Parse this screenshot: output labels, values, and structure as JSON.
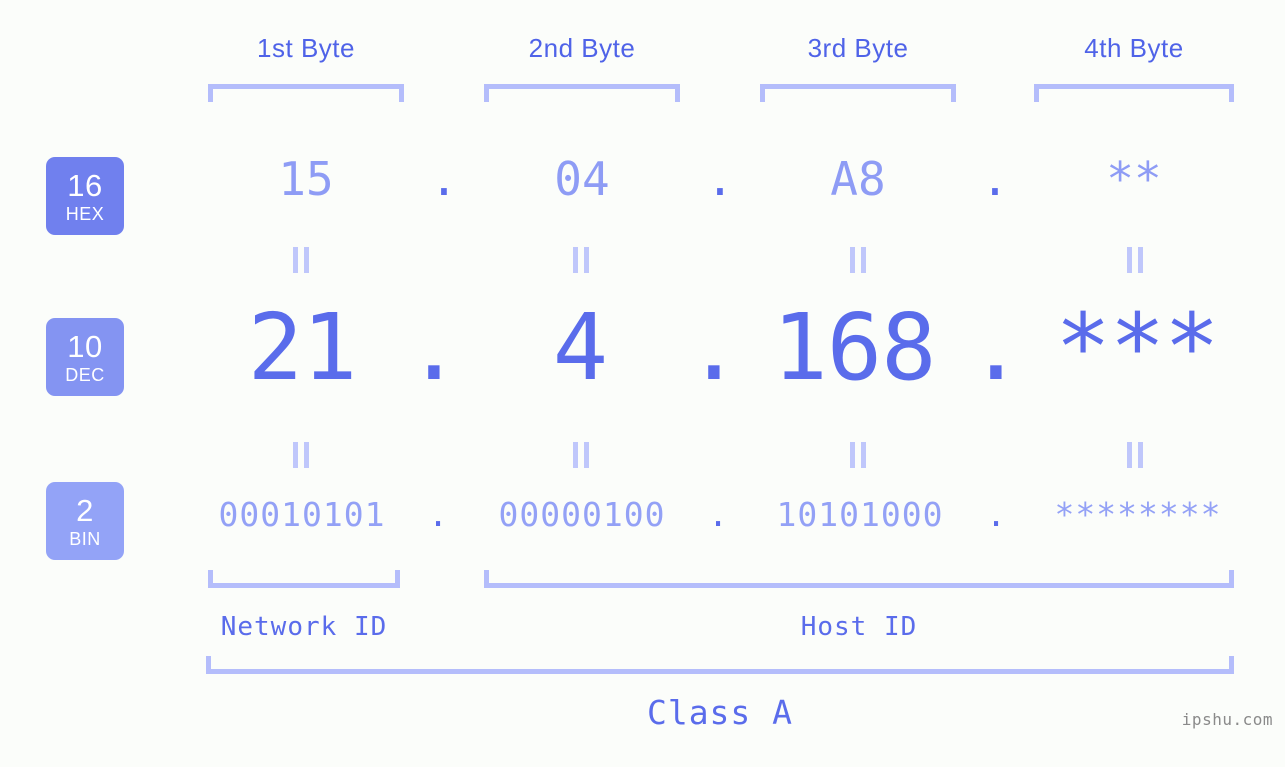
{
  "background_color": "#fbfdfa",
  "accent_color": "#5a6ceb",
  "bracket_color": "#b4bdfb",
  "header": {
    "bytes": [
      {
        "label": "1st Byte"
      },
      {
        "label": "2nd Byte"
      },
      {
        "label": "3rd Byte"
      },
      {
        "label": "4th Byte"
      }
    ]
  },
  "radix_badges": [
    {
      "number": "16",
      "name": "HEX",
      "color": "#7080ee"
    },
    {
      "number": "10",
      "name": "DEC",
      "color": "#8494f2"
    },
    {
      "number": "2",
      "name": "BIN",
      "color": "#93a3f7"
    }
  ],
  "rows": {
    "hex": {
      "values": [
        "15",
        "04",
        "A8",
        "**"
      ],
      "separator": "."
    },
    "dec": {
      "values": [
        "21",
        "4",
        "168",
        "***"
      ],
      "separator": "."
    },
    "bin": {
      "values": [
        "00010101",
        "00000100",
        "10101000",
        "********"
      ],
      "separator": "."
    }
  },
  "equals_marker": "=",
  "footer": {
    "network_id_label": "Network ID",
    "host_id_label": "Host ID",
    "class_label": "Class A",
    "watermark": "ipshu.com"
  }
}
